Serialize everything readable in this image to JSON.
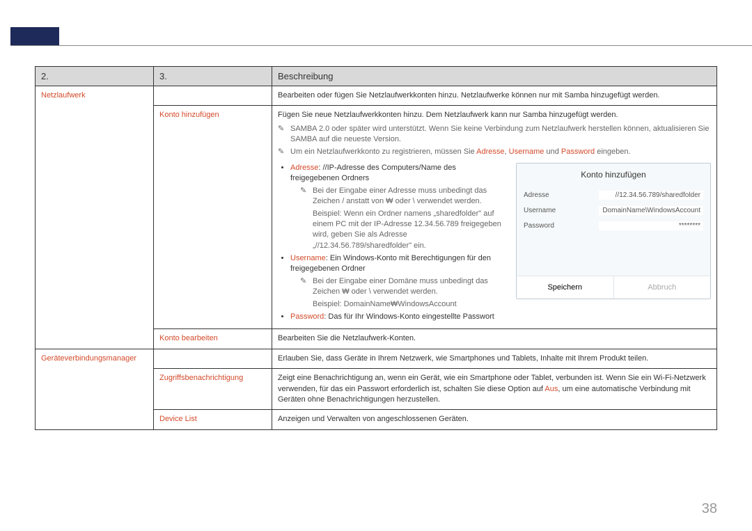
{
  "header": {
    "col1": "2.",
    "col2": "3.",
    "col3": "Beschreibung"
  },
  "rows": {
    "netzlaufwerk": {
      "label": "Netzlaufwerk",
      "desc": "Bearbeiten oder fügen Sie Netzlaufwerkkonten hinzu. Netzlaufwerke können nur mit Samba hinzugefügt werden."
    },
    "kontoHinzu": {
      "label": "Konto hinzufügen",
      "line1": "Fügen Sie neue Netzlaufwerkkonten hinzu. Dem Netzlaufwerk kann nur Samba hinzugefügt werden.",
      "note1": "SAMBA 2.0 oder später wird unterstützt. Wenn Sie keine Verbindung zum Netzlaufwerk herstellen können, aktualisieren Sie SAMBA auf die neueste Version.",
      "note2_pre": "Um ein Netzlaufwerkkonto zu registrieren, müssen Sie ",
      "note2_a": "Adresse",
      "note2_sep": ", ",
      "note2_u": "Username",
      "note2_and": " und ",
      "note2_p": "Password",
      "note2_post": " eingeben.",
      "b1_label": "Adresse",
      "b1_text": ": //IP-Adresse des Computers/Name des freigegebenen Ordners",
      "b1_note1": "Bei der Eingabe einer Adresse muss unbedingt das Zeichen / anstatt von ₩ oder \\ verwendet werden.",
      "b1_note2": "Beispiel: Wenn ein Ordner namens „sharedfolder\" auf einem PC mit der IP-Adresse 12.34.56.789 freigegeben wird, geben Sie als Adresse „//12.34.56.789/sharedfolder\" ein.",
      "b2_label": "Username",
      "b2_text": ": Ein Windows-Konto mit Berechtigungen für den freigegebenen Ordner",
      "b2_note1": "Bei der Eingabe einer Domäne muss unbedingt das Zeichen ₩ oder \\ verwendet werden.",
      "b2_note2": "Beispiel: DomainName₩WindowsAccount",
      "b3_label": "Password",
      "b3_text": ": Das für Ihr Windows-Konto eingestellte Passwort"
    },
    "kontoBearb": {
      "label": "Konto bearbeiten",
      "desc": "Bearbeiten Sie die Netzlaufwerk-Konten."
    },
    "geraete": {
      "label": "Geräteverbindungsmanager",
      "desc": "Erlauben Sie, dass Geräte in Ihrem Netzwerk, wie Smartphones und Tablets, Inhalte mit Ihrem Produkt teilen."
    },
    "zugriff": {
      "label": "Zugriffsbenachrichtigung",
      "d1": "Zeigt eine Benachrichtigung an, wenn ein Gerät, wie ein Smartphone oder Tablet, verbunden ist. Wenn Sie ein Wi-Fi-Netzwerk verwenden, für das ein Passwort erforderlich ist, schalten Sie diese Option auf ",
      "d_aus": "Aus",
      "d2": ", um eine automatische Verbindung mit Geräten ohne Benachrichtigungen herzustellen."
    },
    "devlist": {
      "label": "Device List",
      "desc": "Anzeigen und Verwalten von angeschlossenen Geräten."
    }
  },
  "panel": {
    "title": "Konto hinzufügen",
    "adresse_label": "Adresse",
    "adresse_value": "//12.34.56.789/sharedfolder",
    "username_label": "Username",
    "username_value": "DomainName\\WindowsAccount",
    "password_label": "Password",
    "password_value": "********",
    "save": "Speichern",
    "cancel": "Abbruch"
  },
  "pageNumber": "38",
  "glyph": {
    "pencil": "✎"
  }
}
